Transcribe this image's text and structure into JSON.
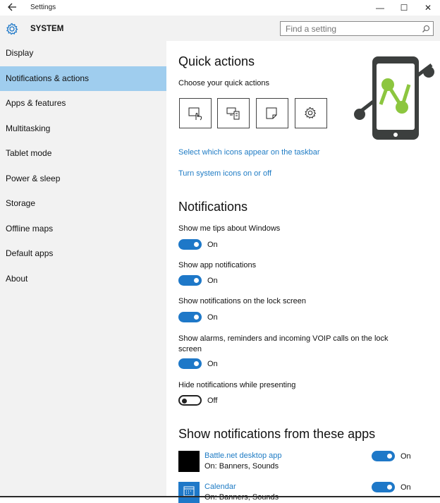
{
  "window": {
    "title": "Settings",
    "back_icon": "back-arrow-icon",
    "minimize": "—",
    "maximize": "☐",
    "close": "✕"
  },
  "header": {
    "section_icon": "gear-icon",
    "title": "SYSTEM",
    "search_placeholder": "Find a setting"
  },
  "sidebar": {
    "items": [
      {
        "label": "Display",
        "active": false
      },
      {
        "label": "Notifications & actions",
        "active": true
      },
      {
        "label": "Apps & features",
        "active": false
      },
      {
        "label": "Multitasking",
        "active": false
      },
      {
        "label": "Tablet mode",
        "active": false
      },
      {
        "label": "Power & sleep",
        "active": false
      },
      {
        "label": "Storage",
        "active": false
      },
      {
        "label": "Offline maps",
        "active": false
      },
      {
        "label": "Default apps",
        "active": false
      },
      {
        "label": "About",
        "active": false
      }
    ],
    "active_color": "#9fcdee"
  },
  "quick_actions": {
    "heading": "Quick actions",
    "subheading": "Choose your quick actions",
    "tiles": [
      "tablet-mode-icon",
      "connect-icon",
      "note-icon",
      "settings-icon"
    ],
    "link1": "Select which icons appear on the taskbar",
    "link2": "Turn system icons on or off"
  },
  "notifications": {
    "heading": "Notifications",
    "settings": [
      {
        "label": "Show me tips about Windows",
        "state": "On"
      },
      {
        "label": "Show app notifications",
        "state": "On"
      },
      {
        "label": "Show notifications on the lock screen",
        "state": "On"
      },
      {
        "label": "Show alarms, reminders and incoming VOIP calls on the lock screen",
        "state": "On"
      },
      {
        "label": "Hide notifications while presenting",
        "state": "Off"
      }
    ]
  },
  "apps": {
    "heading": "Show notifications from these apps",
    "list": [
      {
        "name": "Battle.net desktop app",
        "sub": "On: Banners, Sounds",
        "state": "On",
        "icon": "battle-net-icon"
      },
      {
        "name": "Calendar",
        "sub": "On: Banners, Sounds",
        "state": "On",
        "icon": "calendar-icon"
      }
    ]
  },
  "colors": {
    "accent": "#1e78c8",
    "link": "#1e7bc4",
    "logo_green": "#8cc63f",
    "logo_dark": "#3c3f3e"
  }
}
